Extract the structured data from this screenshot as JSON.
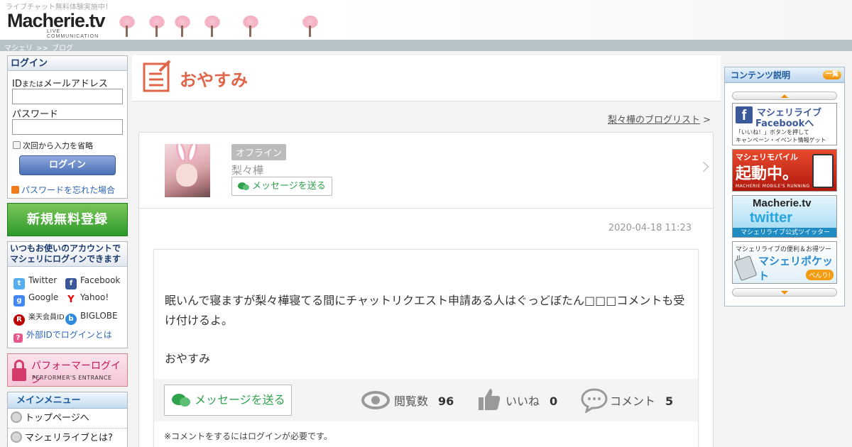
{
  "header": {
    "tagline": "ライブチャット無料体験実施中！",
    "logo_text": "Macherie.tv",
    "logo_sub": "LIVE COMMUNICATION"
  },
  "breadcrumb": {
    "home": "マシェリ",
    "sep": ">>",
    "current": "ブログ"
  },
  "login": {
    "title": "ログイン",
    "id_label_a": "ID",
    "id_label_small": "または",
    "id_label_b": "メールアドレス",
    "password_label": "パスワード",
    "remember_label": "次回から入力を省略",
    "login_button": "ログイン",
    "forgot_link": "パスワードを忘れた場合"
  },
  "register_button": "新規無料登録",
  "external": {
    "title_line1": "いつもお使いのアカウントで",
    "title_line2": "マシェリにログインできます",
    "twitter": "Twitter",
    "facebook": "Facebook",
    "google": "Google",
    "yahoo": "Yahoo!",
    "rakuten": "楽天会員ID",
    "biglobe": "BIGLOBE",
    "whatis": "外部IDでログインとは"
  },
  "performer": {
    "title": "パフォーマーログイン",
    "sub": "PERFORMER'S ENTRANCE"
  },
  "main_menu": {
    "title": "メインメニュー",
    "items": [
      "トップページへ",
      "マシェリライブとは?"
    ]
  },
  "page": {
    "title": "おやすみ",
    "bloglist_link": "梨々樺のブログリスト",
    "bloglist_arrow": ">"
  },
  "profile": {
    "status": "オフライン",
    "name": "梨々樺",
    "message_button": "メッセージを送る"
  },
  "post": {
    "date": "2020-04-18 11:23",
    "body_line1": "眠いんで寝ますが梨々樺寝てる間にチャットリクエスト申請ある人はぐっどぼたん□□□コメントも受け付けるよ。",
    "body_line2": "おやすみ",
    "message_button": "メッセージを送る",
    "views_label": "閲覧数",
    "views": "96",
    "likes_label": "いいね",
    "likes": "0",
    "comments_label": "コメント",
    "comments": "5",
    "note": "※コメントをするにはログインが必要です。"
  },
  "contents": {
    "title": "コンテンツ説明",
    "list_button": "一覧",
    "fb_banner_line1": "マシェリライブ",
    "fb_banner_line2": "Facebookへ",
    "fb_banner_desc1": "「いいね！」ボタンを押して",
    "fb_banner_desc2": "キャンペーン・イベント情報ゲット",
    "mobile_banner_line1": "マシェリモバイル",
    "mobile_banner_line2": "起動中。",
    "mobile_banner_sub": "MACHERIE MOBILE'S RUNNING",
    "tw_banner_logo": "Macherie.tv",
    "tw_banner_word": "twitter",
    "tw_banner_caption": "マシェリライブ公式ツイッター",
    "pocket_banner_line1": "マシェリライブの便利＆お得ツール",
    "pocket_banner_line2": "マシェリポケット",
    "pocket_banner_badge": "べんり!"
  },
  "colors": {
    "title_accent": "#e0664a",
    "message_green": "#2fa34c",
    "register_green": "#2c9a2a",
    "link_blue": "#2b63b5"
  }
}
